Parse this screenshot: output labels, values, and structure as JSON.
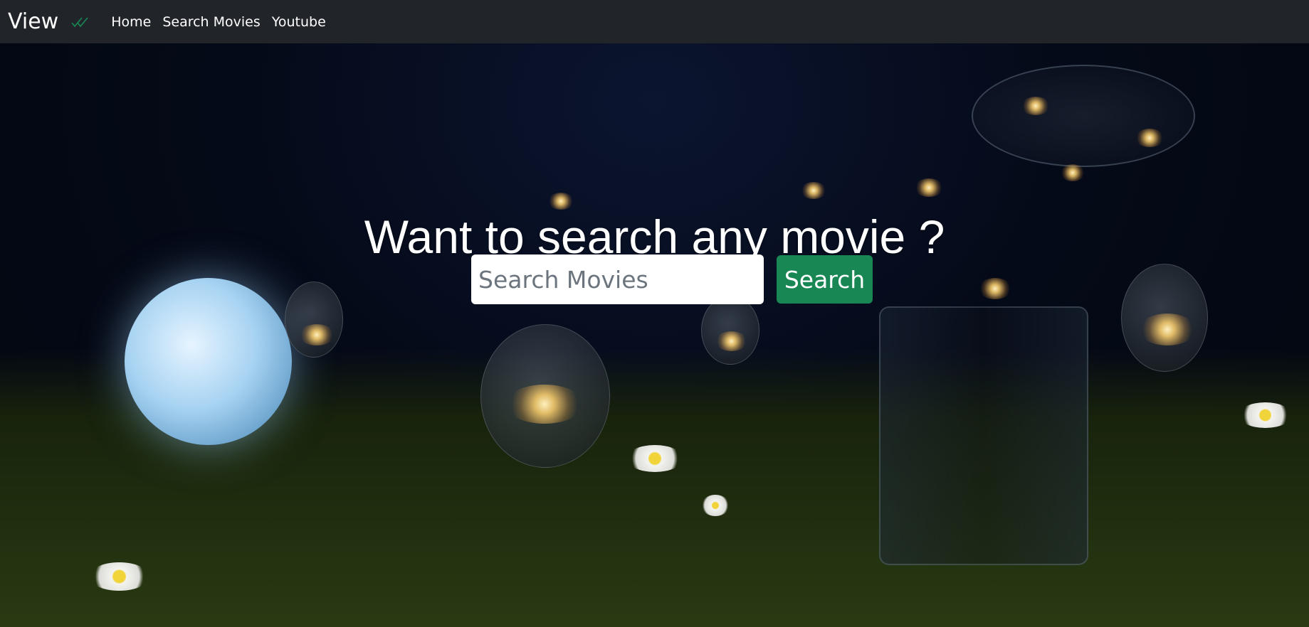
{
  "navbar": {
    "brand": "View",
    "brand_icon": "double-check-icon",
    "links": [
      {
        "label": "Home"
      },
      {
        "label": "Search Movies"
      },
      {
        "label": "Youtube"
      }
    ]
  },
  "hero": {
    "title": "Want to search any movie   ?",
    "search": {
      "placeholder": "Search Movies",
      "value": "",
      "button_label": "Search"
    }
  },
  "colors": {
    "navbar_bg": "#212529",
    "button_green": "#198754",
    "brand_icon_green": "#198754"
  }
}
